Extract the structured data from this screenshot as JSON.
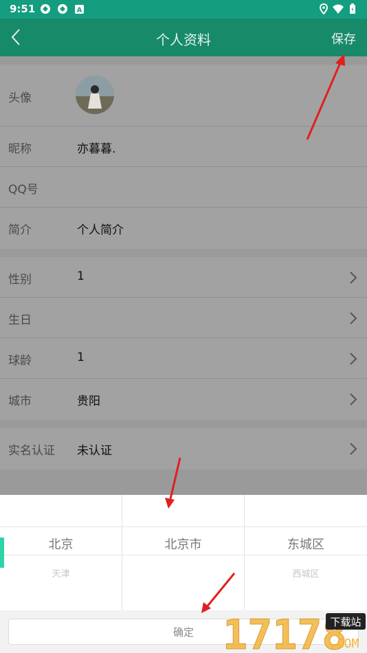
{
  "status_bar": {
    "time": "9:51"
  },
  "app_bar": {
    "title": "个人资料",
    "save_label": "保存"
  },
  "profile": {
    "avatar_label": "头像",
    "nickname_label": "昵称",
    "nickname": "亦暮暮.",
    "qq_label": "QQ号",
    "qq": "",
    "intro_label": "简介",
    "intro": "个人简介"
  },
  "details": {
    "gender_label": "性别",
    "gender": "1",
    "birthday_label": "生日",
    "birthday": "",
    "ball_age_label": "球龄",
    "ball_age": "1",
    "city_label": "城市",
    "city": "贵阳"
  },
  "verify": {
    "label": "实名认证",
    "value": "未认证"
  },
  "picker": {
    "province": {
      "selected": "北京",
      "next": "天津"
    },
    "city": {
      "selected": "北京市",
      "next": ""
    },
    "district": {
      "selected": "东城区",
      "next": "西城区"
    },
    "confirm_label": "确定"
  },
  "colors": {
    "status_bar": "#149d7e",
    "app_bar": "#178a69",
    "overlay_gray": "#a2a2a2",
    "annotation_arrow": "#e02020"
  },
  "watermark": {
    "text": "17178",
    "badge": "下载站",
    "suffix": ".COM"
  }
}
